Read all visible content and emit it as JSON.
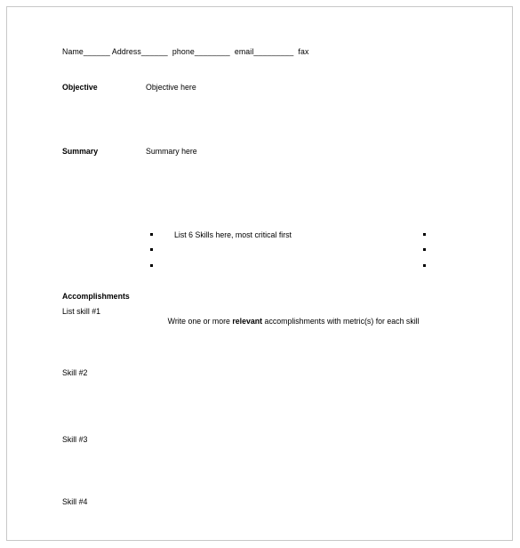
{
  "document": {
    "contact_line": "Name______ Address______  phone________  email_________  fax",
    "sections": {
      "objective": {
        "label": "Objective",
        "content": "Objective here"
      },
      "summary": {
        "label": "Summary",
        "content": "Summary here"
      },
      "skills": {
        "left_bullets": [
          "List 6 Skills here, most critical first",
          "",
          ""
        ],
        "right_bullets": [
          "",
          "",
          ""
        ]
      },
      "accomplishments": {
        "label": "Accomplishments",
        "skill_1_label": "List skill #1",
        "instruction_prefix": "Write one or more ",
        "instruction_emphasis": "relevant",
        "instruction_suffix": " accomplishments with metric(s) for each skill",
        "skill_2_label": "Skill #2",
        "skill_3_label": "Skill #3",
        "skill_4_label": "Skill #4"
      }
    }
  },
  "colors": {
    "page_background": "#ffffff",
    "page_border": "#c8c8c8",
    "text": "#000000"
  }
}
